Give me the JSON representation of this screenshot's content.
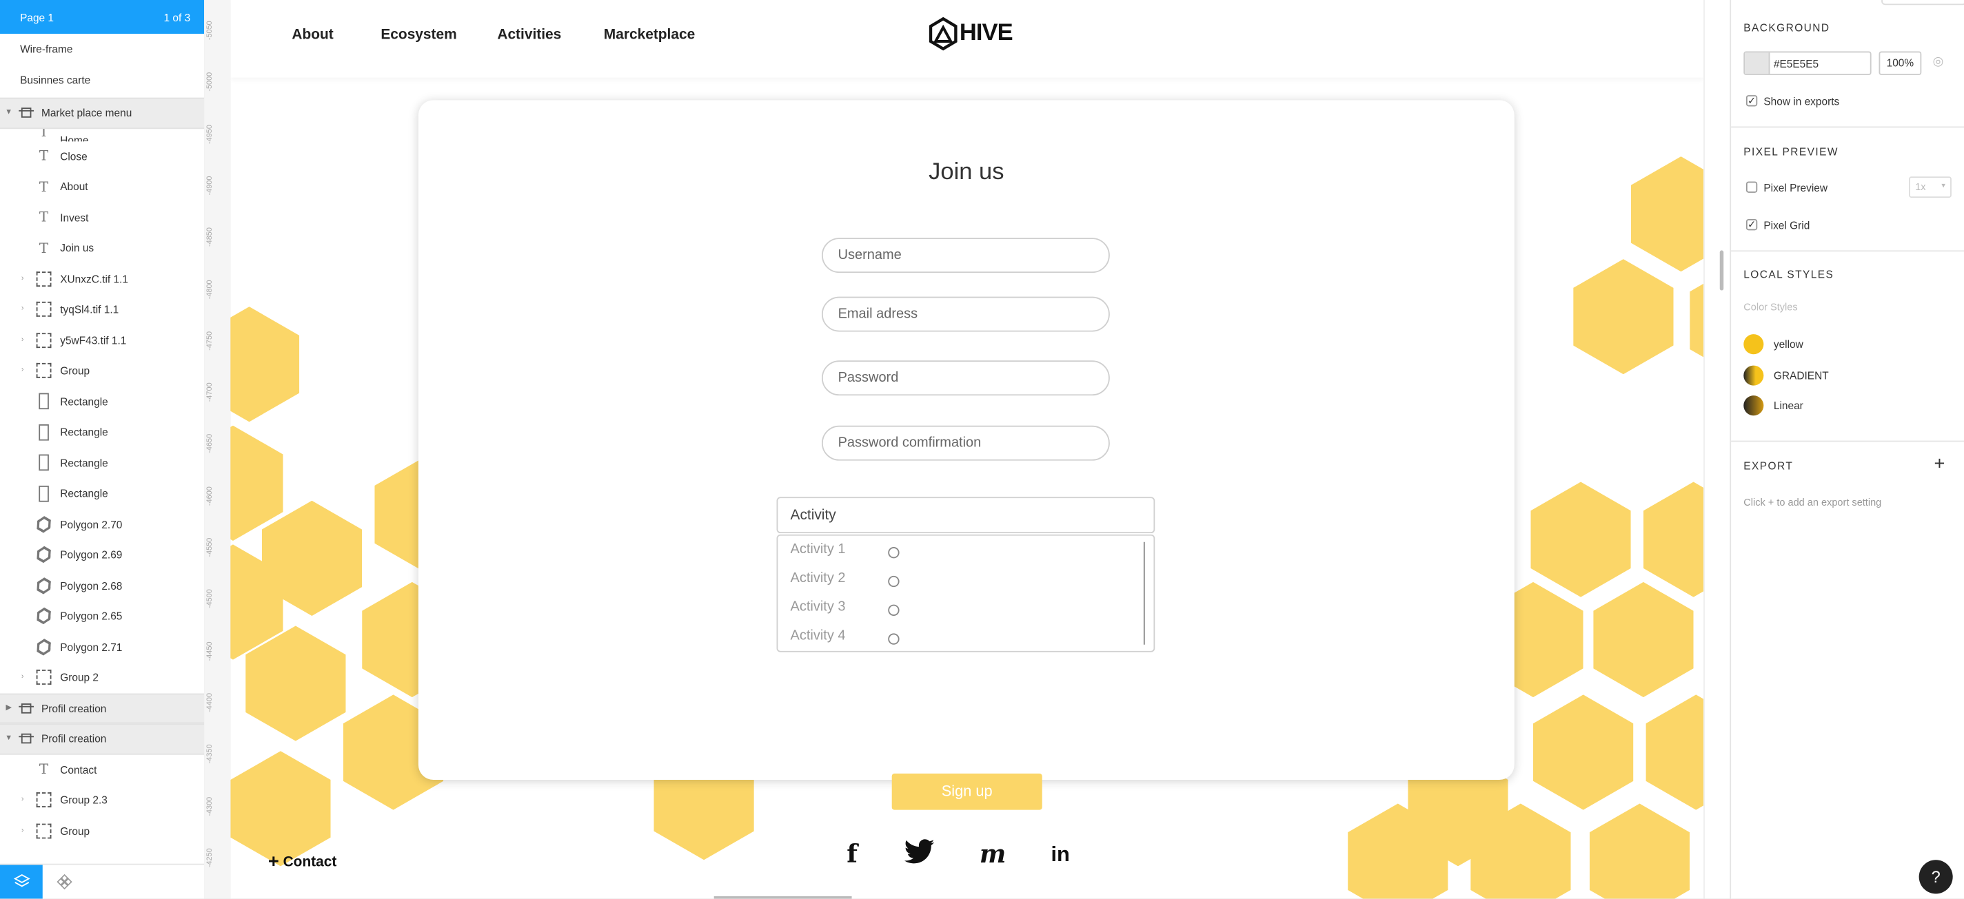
{
  "pages": {
    "current": "Page 1",
    "count_label": "1 of 3",
    "items": [
      "Wire-frame",
      "Businnes carte"
    ]
  },
  "layers": {
    "frame1": "Market place menu",
    "partial_top": "Home",
    "items": [
      {
        "label": "Close",
        "type": "text"
      },
      {
        "label": "About",
        "type": "text"
      },
      {
        "label": "Invest",
        "type": "text"
      },
      {
        "label": "Join us",
        "type": "text"
      },
      {
        "label": "XUnxzC.tif 1.1",
        "type": "group"
      },
      {
        "label": "tyqSl4.tif 1.1",
        "type": "group"
      },
      {
        "label": "y5wF43.tif 1.1",
        "type": "group"
      },
      {
        "label": "Group",
        "type": "group"
      },
      {
        "label": "Rectangle",
        "type": "rect"
      },
      {
        "label": "Rectangle",
        "type": "rect"
      },
      {
        "label": "Rectangle",
        "type": "rect"
      },
      {
        "label": "Rectangle",
        "type": "rect"
      },
      {
        "label": "Polygon 2.70",
        "type": "poly"
      },
      {
        "label": "Polygon 2.69",
        "type": "poly"
      },
      {
        "label": "Polygon 2.68",
        "type": "poly"
      },
      {
        "label": "Polygon 2.65",
        "type": "poly"
      },
      {
        "label": "Polygon 2.71",
        "type": "poly"
      },
      {
        "label": "Group 2",
        "type": "group"
      }
    ],
    "frame2": "Profil creation",
    "frame3": "Profil creation",
    "items2": [
      {
        "label": "Contact",
        "type": "text"
      },
      {
        "label": "Group 2.3",
        "type": "group"
      },
      {
        "label": "Group",
        "type": "group"
      }
    ]
  },
  "ruler": [
    "-5050",
    "-5000",
    "-4950",
    "-4900",
    "-4850",
    "-4800",
    "-4750",
    "-4700",
    "-4650",
    "-4600",
    "-4550",
    "-4500",
    "-4450",
    "-4400",
    "-4350",
    "-4300",
    "-4250",
    "00"
  ],
  "site": {
    "nav": [
      "About",
      "Ecosystem",
      "Activities",
      "Marcketplace"
    ],
    "logo_text": "HIVE",
    "title": "Join us",
    "placeholders": {
      "username": "Username",
      "email": "Email adress",
      "password": "Password",
      "confirm": "Password comfirmation"
    },
    "activity_label": "Activity",
    "activities": [
      "Activity 1",
      "Activity 2",
      "Activity 3",
      "Activity 4"
    ],
    "signup": "Sign up",
    "contact": "Contact",
    "social": [
      "f",
      "m",
      "in"
    ]
  },
  "design": {
    "background_title": "BACKGROUND",
    "bg_hex": "#E5E5E5",
    "bg_opacity": "100%",
    "show_exports": "Show in exports",
    "pixel_title": "PIXEL PREVIEW",
    "pixel_preview": "Pixel Preview",
    "pixel_scale": "1x",
    "pixel_grid": "Pixel Grid",
    "local_title": "LOCAL STYLES",
    "color_styles": "Color Styles",
    "styles": [
      "yellow",
      "GRADIENT",
      "Linear"
    ],
    "export_title": "EXPORT",
    "export_hint": "Click + to add an export setting",
    "help": "?"
  },
  "colors": {
    "accent": "#18a0fb",
    "honey": "#fbd668",
    "yellow": "#f5c21b"
  }
}
